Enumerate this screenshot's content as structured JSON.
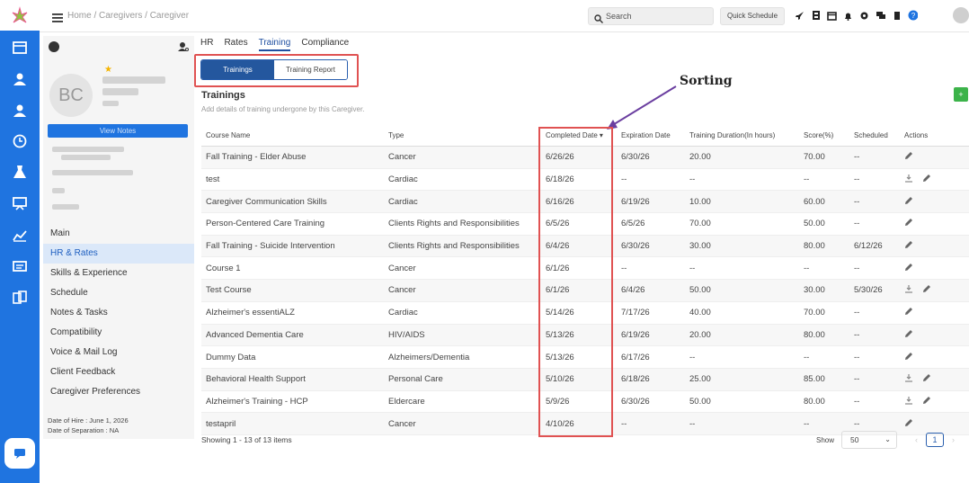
{
  "breadcrumb": "Home / Caregivers / Caregiver",
  "search": {
    "label": "Search"
  },
  "quick_schedule": "Quick Schedule",
  "profile": {
    "initials": "BC",
    "view_notes": "View Notes",
    "star": "★"
  },
  "menu": [
    {
      "label": "Main",
      "active": false
    },
    {
      "label": "HR & Rates",
      "active": true
    },
    {
      "label": "Skills & Experience",
      "active": false
    },
    {
      "label": "Schedule",
      "active": false
    },
    {
      "label": "Notes & Tasks",
      "active": false
    },
    {
      "label": "Compatibility",
      "active": false
    },
    {
      "label": "Voice & Mail Log",
      "active": false
    },
    {
      "label": "Client Feedback",
      "active": false
    },
    {
      "label": "Caregiver Preferences",
      "active": false
    }
  ],
  "dates": {
    "hire": "Date of Hire : June 1, 2026",
    "separation": "Date of Separation : NA"
  },
  "tabs": [
    "HR",
    "Rates",
    "Training",
    "Compliance"
  ],
  "active_tab": "Training",
  "segments": {
    "trainings": "Trainings",
    "report": "Training Report"
  },
  "section": {
    "title": "Trainings",
    "subtitle": "Add details of training undergone by this Caregiver."
  },
  "annotation": "Sorting",
  "add_button": "+",
  "table": {
    "headers": [
      "Course Name",
      "Type",
      "Completed Date",
      "Expiration Date",
      "Training Duration(In hours)",
      "Score(%)",
      "Scheduled",
      "Actions"
    ],
    "sort_indicator": "▾",
    "rows": [
      {
        "course": "Fall Training - Elder Abuse",
        "type": "Cancer",
        "completed": "6/26/26",
        "expiration": "6/30/26",
        "duration": "20.00",
        "score": "70.00",
        "scheduled": "--",
        "download": false
      },
      {
        "course": "test",
        "type": "Cardiac",
        "completed": "6/18/26",
        "expiration": "--",
        "duration": "--",
        "score": "--",
        "scheduled": "--",
        "download": true
      },
      {
        "course": "Caregiver Communication Skills",
        "type": "Cardiac",
        "completed": "6/16/26",
        "expiration": "6/19/26",
        "duration": "10.00",
        "score": "60.00",
        "scheduled": "--",
        "download": false
      },
      {
        "course": "Person-Centered Care Training",
        "type": "Clients Rights and Responsibilities",
        "completed": "6/5/26",
        "expiration": "6/5/26",
        "duration": "70.00",
        "score": "50.00",
        "scheduled": "--",
        "download": false
      },
      {
        "course": "Fall Training - Suicide Intervention",
        "type": "Clients Rights and Responsibilities",
        "completed": "6/4/26",
        "expiration": "6/30/26",
        "duration": "30.00",
        "score": "80.00",
        "scheduled": "6/12/26",
        "download": false
      },
      {
        "course": "Course 1",
        "type": "Cancer",
        "completed": "6/1/26",
        "expiration": "--",
        "duration": "--",
        "score": "--",
        "scheduled": "--",
        "download": false
      },
      {
        "course": "Test Course",
        "type": "Cancer",
        "completed": "6/1/26",
        "expiration": "6/4/26",
        "duration": "50.00",
        "score": "30.00",
        "scheduled": "5/30/26",
        "download": true
      },
      {
        "course": "Alzheimer's essentiALZ",
        "type": "Cardiac",
        "completed": "5/14/26",
        "expiration": "7/17/26",
        "duration": "40.00",
        "score": "70.00",
        "scheduled": "--",
        "download": false
      },
      {
        "course": "Advanced Dementia Care",
        "type": "HIV/AIDS",
        "completed": "5/13/26",
        "expiration": "6/19/26",
        "duration": "20.00",
        "score": "80.00",
        "scheduled": "--",
        "download": false
      },
      {
        "course": "Dummy Data",
        "type": "Alzheimers/Dementia",
        "completed": "5/13/26",
        "expiration": "6/17/26",
        "duration": "--",
        "score": "--",
        "scheduled": "--",
        "download": false
      },
      {
        "course": "Behavioral Health Support",
        "type": "Personal Care",
        "completed": "5/10/26",
        "expiration": "6/18/26",
        "duration": "25.00",
        "score": "85.00",
        "scheduled": "--",
        "download": true
      },
      {
        "course": "Alzheimer's Training - HCP",
        "type": "Eldercare",
        "completed": "5/9/26",
        "expiration": "6/30/26",
        "duration": "50.00",
        "score": "80.00",
        "scheduled": "--",
        "download": true
      },
      {
        "course": "testapril",
        "type": "Cancer",
        "completed": "4/10/26",
        "expiration": "--",
        "duration": "--",
        "score": "--",
        "scheduled": "--",
        "download": false
      }
    ]
  },
  "footer": {
    "showing": "Showing 1 - 13 of 13 items",
    "show_label": "Show",
    "page_size": "50",
    "page": "1",
    "prev": "‹",
    "next": "›"
  },
  "colors": {
    "primary": "#1f74e0",
    "highlight": "#e05252",
    "success": "#3cb34a",
    "annotation_arrow": "#6b3fa0"
  }
}
